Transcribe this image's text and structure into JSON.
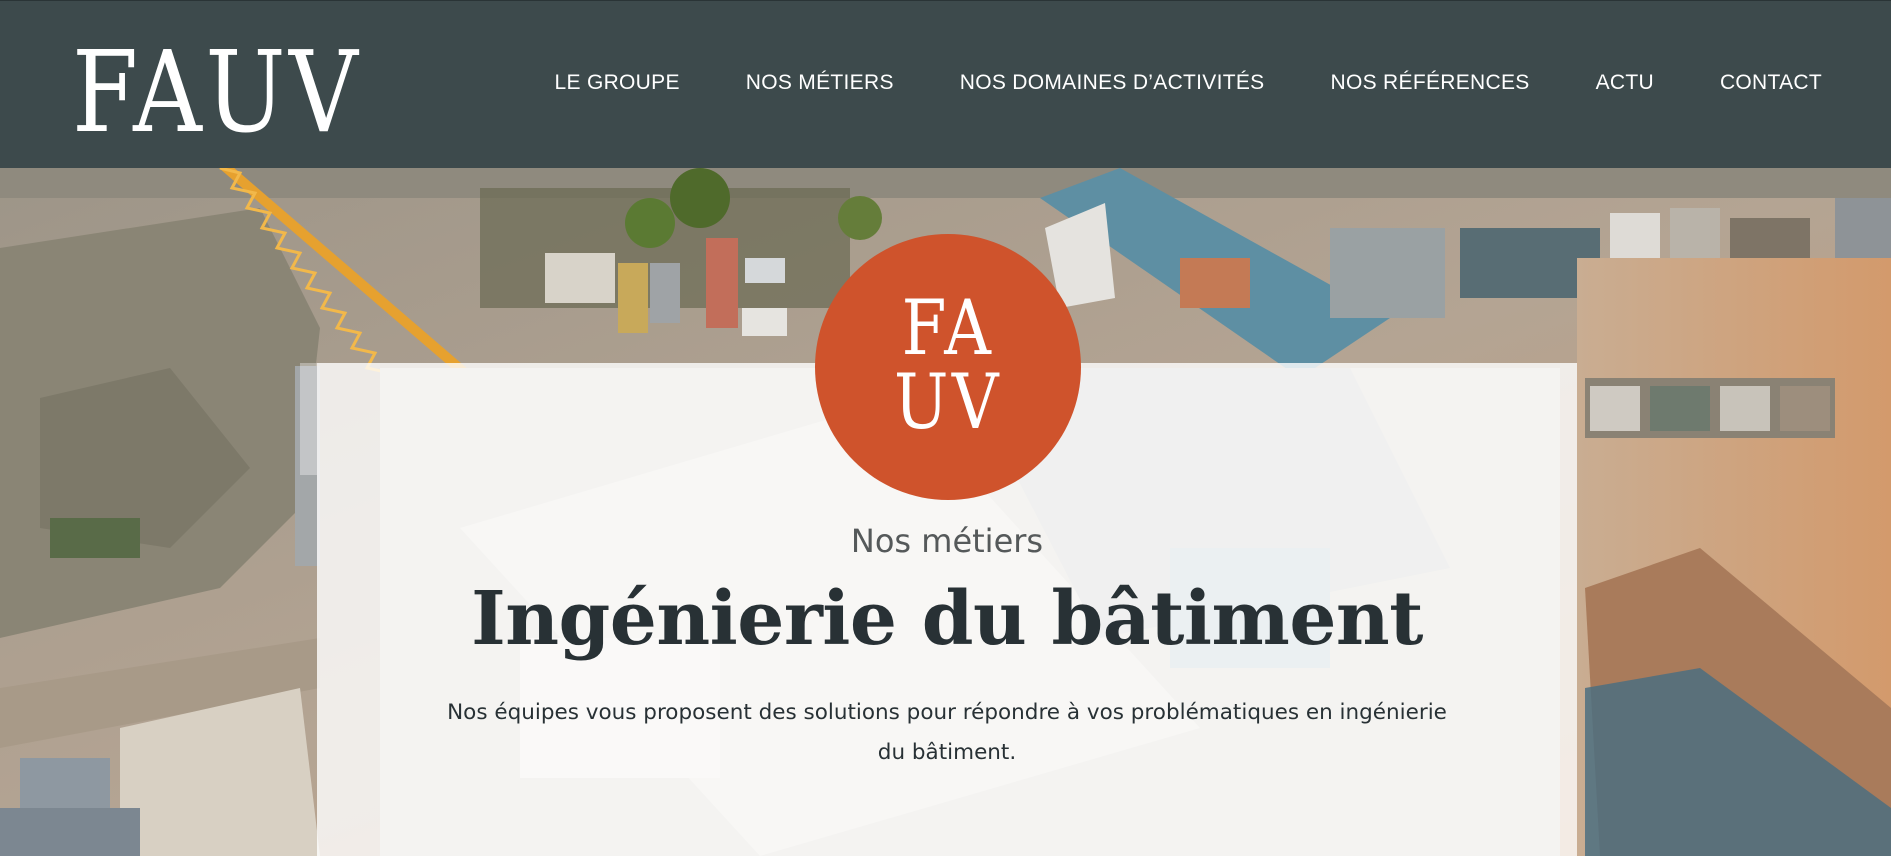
{
  "brand": {
    "logo_text": "FAUV",
    "badge_line1": "FA",
    "badge_line2": "UV"
  },
  "nav": {
    "items": [
      {
        "label": "LE GROUPE"
      },
      {
        "label": "NOS MÉTIERS"
      },
      {
        "label": "NOS DOMAINES D’ACTIVITÉS"
      },
      {
        "label": "NOS RÉFÉRENCES"
      },
      {
        "label": "ACTU"
      },
      {
        "label": "CONTACT"
      }
    ]
  },
  "hero": {
    "eyebrow": "Nos métiers",
    "title": "Ingénierie du bâtiment",
    "description": "Nos équipes vous proposent des solutions pour répondre à vos problématiques en ingénierie du bâtiment.",
    "image_subject": "aerial-construction-site"
  },
  "colors": {
    "header_bg": "#3d4a4c",
    "accent": "#cf532c",
    "title_text": "#283135"
  }
}
